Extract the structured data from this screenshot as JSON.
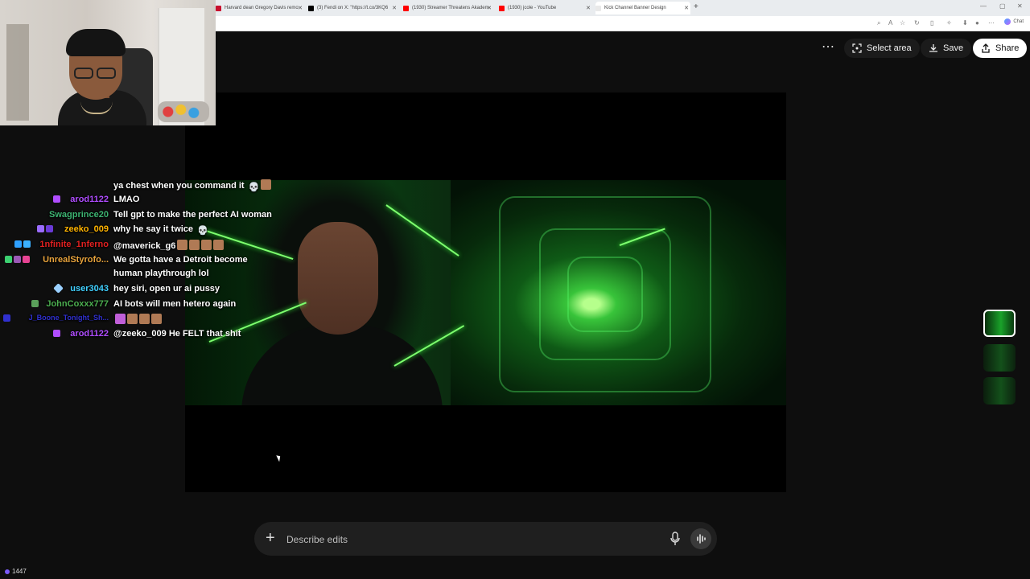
{
  "browser": {
    "tabs": [
      {
        "title": "Harvard dean Gregory Davis remo",
        "color": "#c8102e"
      },
      {
        "title": "(3) Fendi on X: \"https://t.co/3KQ6",
        "color": "#000000"
      },
      {
        "title": "(1930) Streamer Threatens Akadem",
        "color": "#ff0000"
      },
      {
        "title": "(1930) jcole - YouTube",
        "color": "#ff0000"
      },
      {
        "title": "Kick Channel Banner Design",
        "color": "#e9e9e9"
      }
    ],
    "chat_label": "Chat"
  },
  "header": {
    "more_label": "⋯",
    "select_area_label": "Select area",
    "save_label": "Save",
    "share_label": "Share"
  },
  "chat": {
    "messages": [
      {
        "user": "",
        "user_color": "#ffffff",
        "text": "ya chest when you command it",
        "emote": "💀"
      },
      {
        "user": "arod1122",
        "user_color": "#b04dff",
        "text": "LMAO"
      },
      {
        "user": "Swagprince20",
        "user_color": "#3cb371",
        "text": "Tell gpt to make the perfect AI woman"
      },
      {
        "user": "zeeko_009",
        "user_color": "#ffb300",
        "text": "why he say it twice",
        "emote": "💀"
      },
      {
        "user": "1nfinite_1nferno",
        "user_color": "#e02020",
        "text": "@maverick_g6"
      },
      {
        "user": "UnrealStyrofo...",
        "user_color": "#e8a33c",
        "text": "We gotta have a Detroit become"
      },
      {
        "user": "",
        "user_color": "#ffffff",
        "text": "human playthrough lol"
      },
      {
        "user": "user3043",
        "user_color": "#40d0ff",
        "text": "hey siri, open ur ai pussy"
      },
      {
        "user": "JohnCoxxx777",
        "user_color": "#4caf50",
        "text": "AI bots will men hetero again"
      },
      {
        "user": "J_Boone_Tonight_Sh...",
        "user_color": "#3030d0",
        "text": ""
      },
      {
        "user": "arod1122",
        "user_color": "#b04dff",
        "text": "@zeeko_009 He FELT that shit"
      }
    ],
    "viewer_count": "1447"
  },
  "prompt": {
    "placeholder": "Describe edits"
  }
}
